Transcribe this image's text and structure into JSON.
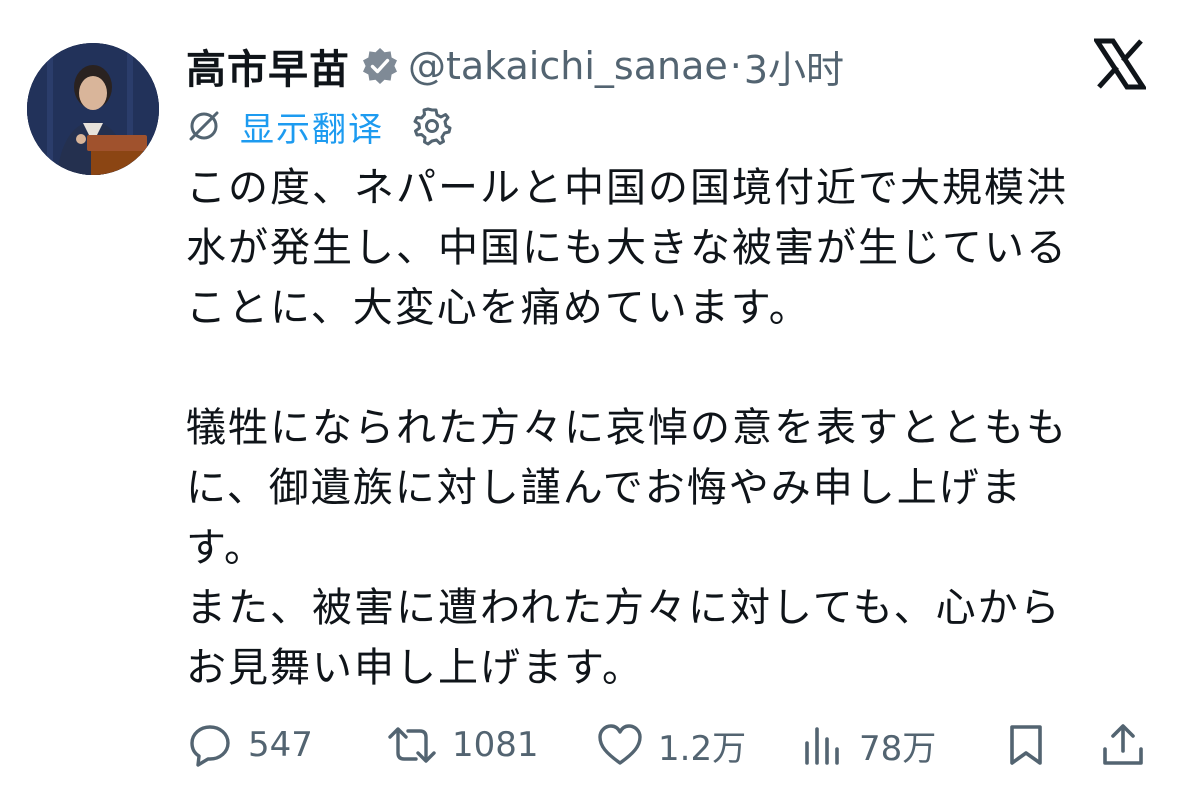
{
  "author": {
    "display_name": "高市早苗",
    "handle": "@takaichi_sanae",
    "separator": "·",
    "time": "3小时",
    "verified": true
  },
  "translate": {
    "label": "显示翻译"
  },
  "tweet_lines": [
    "この度、ネパールと中国の国境付近で大規模洪",
    "水が発生し、中国にも大きな被害が生じている",
    "ことに、大変心を痛めています。",
    "",
    "犠牲になられた方々に哀悼の意を表すとともも",
    "に、御遺族に対し謹んでお悔やみ申し上げま",
    "す。",
    "また、被害に遭われた方々に対しても、心から",
    "お見舞い申し上げます。"
  ],
  "actions": {
    "replies": "547",
    "reposts": "1081",
    "likes": "1.2万",
    "views": "78万"
  },
  "colors": {
    "text": "#0f1419",
    "muted": "#536471",
    "link": "#1d9bf0"
  },
  "icons": {
    "verified": "verified-badge-icon",
    "translate": "translate-icon",
    "settings": "gear-icon",
    "platform": "x-logo-icon",
    "reply": "reply-icon",
    "repost": "repost-icon",
    "like": "heart-icon",
    "views": "views-icon",
    "bookmark": "bookmark-icon",
    "share": "share-icon"
  }
}
